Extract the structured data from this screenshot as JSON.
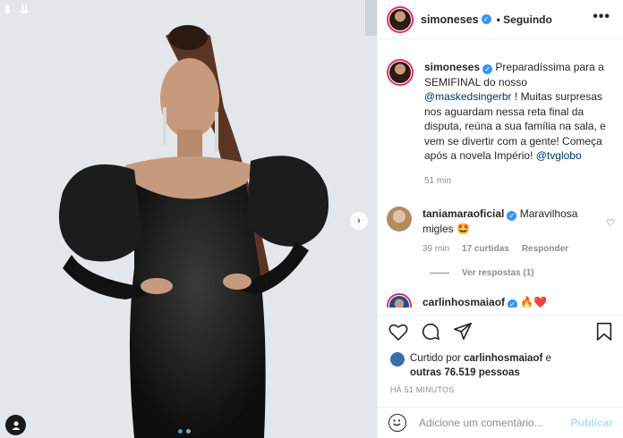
{
  "post": {
    "author": "simoneses",
    "follow_status": "Seguindo",
    "more": "•••",
    "caption_prefix": "Preparadíssima para a SEMIFINAL do nosso ",
    "caption_mention1": "@maskedsingerbr",
    "caption_mid": " ! Muitas surpresas nos aguardam nessa reta final da disputa, reúna a sua família na sala, e vem se divertir com a gente! Começa após a novela Império! ",
    "caption_mention2": "@tvglobo",
    "caption_time": "51 min"
  },
  "comments": [
    {
      "user": "taniamaraoficial",
      "text": "Maravilhosa migles 🤩",
      "time": "39 min",
      "likes": "17 curtidas",
      "reply": "Responder",
      "view_replies": "Ver respostas (1)"
    },
    {
      "user": "carlinhosmaiaof",
      "text": "🔥❤️"
    }
  ],
  "likes": {
    "prefix": "Curtido por ",
    "user": "carlinhosmaiaof",
    "mid": " e",
    "others": "outras 76.519 pessoas"
  },
  "timestamp": "HÁ 51 MINUTOS",
  "comment_box": {
    "placeholder": "Adicione um comentário...",
    "publish": "Publicar"
  },
  "colors": {
    "accent": "#3897f0",
    "link": "#00376b",
    "muted": "#8e8e8e",
    "publish_disabled": "#b2dffc"
  }
}
